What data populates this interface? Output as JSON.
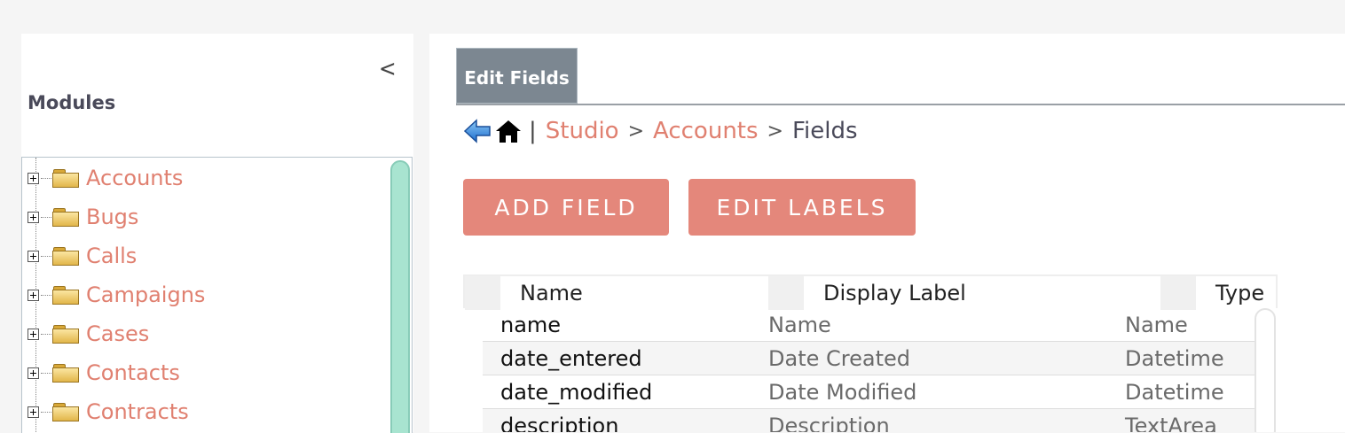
{
  "sidebar": {
    "collapse_glyph": "<",
    "title": "Modules",
    "modules": [
      {
        "label": "Accounts"
      },
      {
        "label": "Bugs"
      },
      {
        "label": "Calls"
      },
      {
        "label": "Campaigns"
      },
      {
        "label": "Cases"
      },
      {
        "label": "Contacts"
      },
      {
        "label": "Contracts"
      }
    ]
  },
  "tabs": [
    {
      "label": "Edit Fields",
      "active": true
    }
  ],
  "breadcrumb": {
    "separator": "|",
    "items": [
      "Studio",
      "Accounts",
      "Fields"
    ],
    "arrow": ">"
  },
  "actions": {
    "add_field": "ADD FIELD",
    "edit_labels": "EDIT LABELS"
  },
  "table": {
    "headers": [
      "Name",
      "Display Label",
      "Type"
    ],
    "rows": [
      {
        "name": "name",
        "label": "Name",
        "type": "Name"
      },
      {
        "name": "date_entered",
        "label": "Date Created",
        "type": "Datetime"
      },
      {
        "name": "date_modified",
        "label": "Date Modified",
        "type": "Datetime"
      },
      {
        "name": "description",
        "label": "Description",
        "type": "TextArea"
      }
    ]
  },
  "colors": {
    "accent": "#e4877b",
    "link": "#e08070",
    "tab_active": "#7c8791",
    "scrollbar": "#a8e4d0"
  },
  "icons": [
    "collapse-chevron-icon",
    "expand-plus-icon",
    "folder-icon",
    "back-arrow-icon",
    "home-icon"
  ]
}
